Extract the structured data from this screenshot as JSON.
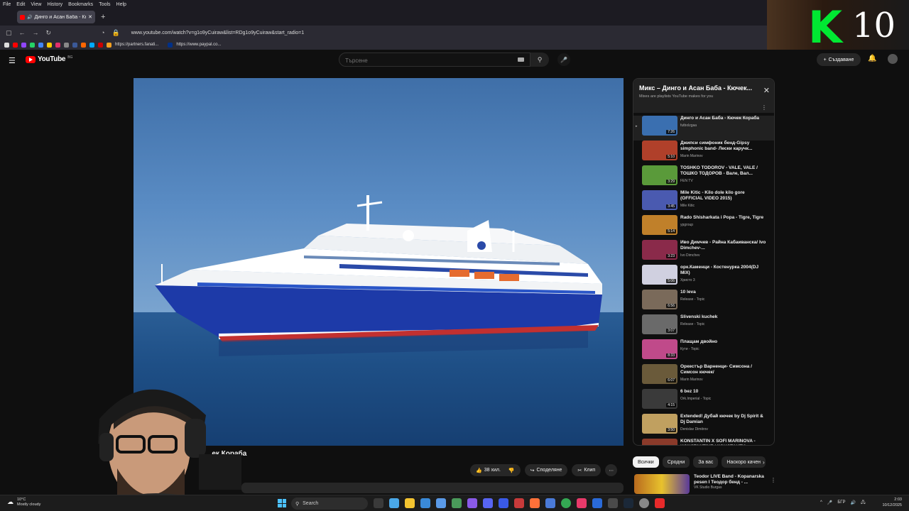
{
  "browser": {
    "menu": [
      "File",
      "Edit",
      "View",
      "History",
      "Bookmarks",
      "Tools",
      "Help"
    ],
    "tab_title": "Динго и Асан Баба - Кючек",
    "url": "www.youtube.com/watch?v=g1o9yCuiraw&list=RDg1o9yCuiraw&start_radio=1",
    "bookmarks": [
      "https://partners.fanati...",
      "https://www.paypal.co..."
    ]
  },
  "youtube": {
    "logo_text": "YouTube",
    "country_code": "BG",
    "search_placeholder": "Търсене",
    "create_label": "Създаване",
    "video_title": "...ек Кораба",
    "actions": {
      "like": "38 хил.",
      "share": "Споделяне",
      "clip": "Клип"
    }
  },
  "playlist": {
    "title": "Микс – Динго и Асан Баба - Кючек...",
    "subtitle": "Mixes are playlists YouTube makes for you",
    "items": [
      {
        "title": "Динго и Асан Баба - Кючек Кораба",
        "channel": "futbolzgaa",
        "duration": "7:26",
        "color": "#3a6fb0"
      },
      {
        "title": "Джипси симфоник бенд-Gipsy simphonic band- Лески каручк...",
        "channel": "Marin Marinov",
        "duration": "5:10",
        "color": "#b0402a"
      },
      {
        "title": "TOSHKO TODOROV - VALE, VALE / ТОШКО ТОДОРОВ - Вале, Вал...",
        "channel": "FEN TV",
        "duration": "3:29",
        "color": "#5a9a3a"
      },
      {
        "title": "Mile Kitic - Kilo dole kilo gore (OFFICIAL VIDEO 2015)",
        "channel": "Mile Kitic",
        "duration": "3:45",
        "color": "#4a5ab0"
      },
      {
        "title": "Rado Shisharkata i Popa - Tigre, Tigre",
        "channel": "ypgroup",
        "duration": "5:14",
        "color": "#c0802a"
      },
      {
        "title": "Иво Димчев - Райна Кабаиванска/ Ivo Dimchev-...",
        "channel": "Ivo Dimchev",
        "duration": "3:23",
        "color": "#8a2a4a"
      },
      {
        "title": "орк.Каменци - Костенурка 2004(DJ MIX)",
        "channel": "Христо 3",
        "duration": "5:06",
        "color": "#d0d0e0"
      },
      {
        "title": "10 leva",
        "channel": "Release - Topic",
        "duration": "6:56",
        "color": "#7a6a5a"
      },
      {
        "title": "Slivenski kuchek",
        "channel": "Release - Topic",
        "duration": "3:07",
        "color": "#6a6a6a"
      },
      {
        "title": "Плащам двойно",
        "channel": "Кути - Topic",
        "duration": "8:33",
        "color": "#c04a8a"
      },
      {
        "title": "Оркестър Варненци- Симсона / Симсон кючек/",
        "channel": "Marin Marinov",
        "duration": "6:07",
        "color": "#6a5a3a"
      },
      {
        "title": "6 bez 10",
        "channel": "Ork.Imperial - Topic",
        "duration": "4:15",
        "color": "#3a3a3a"
      },
      {
        "title": "Extended! Дубай кючек by Dj Spirit & Dj Damian",
        "channel": "Denislav Dimitrov",
        "duration": "3:50",
        "color": "#c0a060"
      },
      {
        "title": "KONSTANTIN X SOFI MARINOVA - KONSTANTINE / КОНСТАНТИ...",
        "channel": "",
        "duration": "",
        "color": "#8a3a2a"
      }
    ]
  },
  "chips": [
    "Всички",
    "Сродни",
    "За вас",
    "Наскоро качен"
  ],
  "recommendation": {
    "title": "Teodor LIVE Band - Kopanarska pesen I Теодор бенд - ...",
    "channel": "VK Studio Burgas"
  },
  "taskbar": {
    "weather_temp": "10°C",
    "weather_desc": "Mostly cloudy",
    "search_label": "Search",
    "language": "БГР",
    "time": "2:03",
    "date": "10/12/2025"
  },
  "streamer": {
    "logo_letter": "K",
    "logo_number": "10"
  }
}
